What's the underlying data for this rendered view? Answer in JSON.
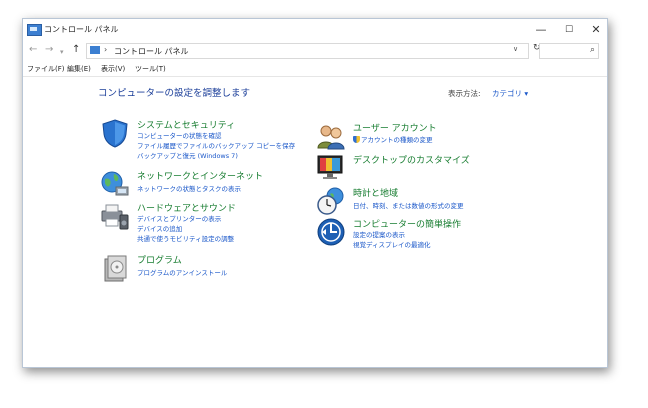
{
  "window": {
    "title": "コントロール パネル",
    "controls": {
      "minimize": "—",
      "maximize": "☐",
      "close": "✕"
    }
  },
  "nav": {
    "back": "←",
    "forward": "→",
    "history": "▾",
    "up": "↑",
    "breadcrumb_sep": "›",
    "address": "コントロール パネル",
    "address_dropdown": "∨",
    "refresh": "↻",
    "search_placeholder": "",
    "search_icon": "⌕"
  },
  "menu": [
    "ファイル(F)",
    "編集(E)",
    "表示(V)",
    "ツール(T)"
  ],
  "content": {
    "heading": "コンピューターの設定を調整します",
    "view_by_label": "表示方法:",
    "view_by_value": "カテゴリ"
  },
  "categories_left": [
    {
      "title": "システムとセキュリティ",
      "icon": "shield-security-icon",
      "links": [
        "コンピューターの状態を確認",
        "ファイル履歴でファイルのバックアップ コピーを保存",
        "バックアップと復元 (Windows 7)"
      ]
    },
    {
      "title": "ネットワークとインターネット",
      "icon": "network-globe-icon",
      "links": [
        "ネットワークの状態とタスクの表示"
      ]
    },
    {
      "title": "ハードウェアとサウンド",
      "icon": "printer-speaker-icon",
      "links": [
        "デバイスとプリンターの表示",
        "デバイスの追加",
        "共通で使うモビリティ設定の調整"
      ]
    },
    {
      "title": "プログラム",
      "icon": "programs-disc-icon",
      "links": [
        "プログラムのアンインストール"
      ]
    }
  ],
  "categories_right": [
    {
      "title": "ユーザー アカウント",
      "icon": "users-icon",
      "links": [
        "アカウントの種類の変更"
      ]
    },
    {
      "title": "デスクトップのカスタマイズ",
      "icon": "monitor-palette-icon",
      "links": []
    },
    {
      "title": "時計と地域",
      "icon": "clock-globe-icon",
      "links": [
        "日付、時刻、または数値の形式の変更"
      ]
    },
    {
      "title": "コンピューターの簡単操作",
      "icon": "ease-of-access-icon",
      "links": [
        "設定の提案の表示",
        "視覚ディスプレイの最適化"
      ]
    }
  ]
}
